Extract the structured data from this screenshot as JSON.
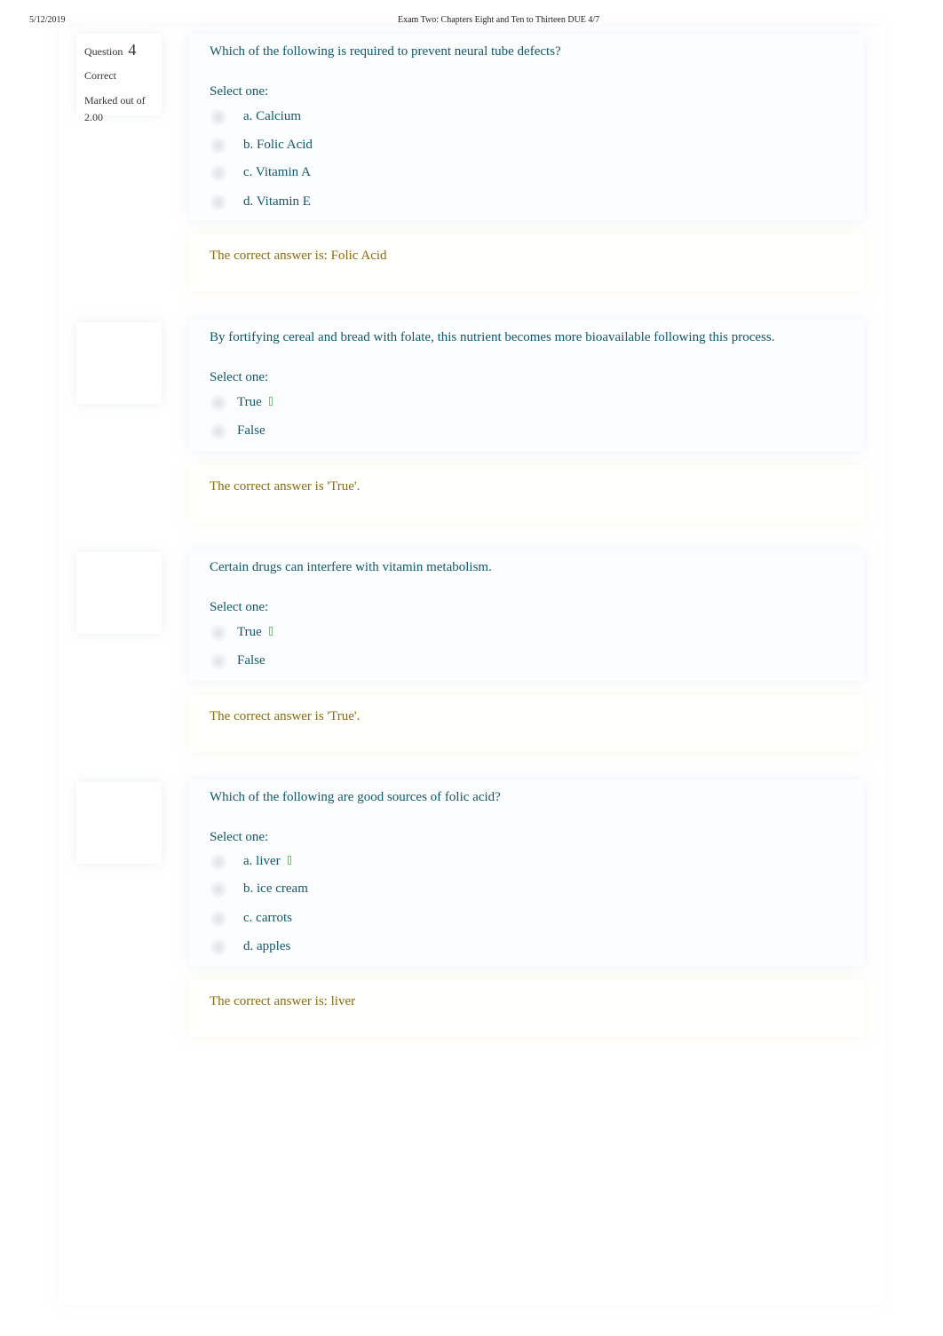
{
  "print_header": {
    "date": "5/12/2019",
    "title": "Exam Two: Chapters Eight and Ten to Thirteen DUE 4/7"
  },
  "colors": {
    "question_text": "#11586a",
    "feedback_text": "#8a6a12",
    "correct_check": "#7cc07c"
  },
  "questions": [
    {
      "info": {
        "label": "Question",
        "number": "4",
        "state": "Correct",
        "grade": "Marked out of 2.00"
      },
      "text": "Which of the following is required to prevent neural tube defects?",
      "prompt": "Select one:",
      "options": [
        {
          "label": "a. Calcium",
          "correct_mark": false
        },
        {
          "label": "b. Folic Acid",
          "correct_mark": false
        },
        {
          "label": "c. Vitamin A",
          "correct_mark": false
        },
        {
          "label": "d. Vitamin E",
          "correct_mark": false
        }
      ],
      "right_answer": "The correct answer is: Folic Acid"
    },
    {
      "info": null,
      "text": "By fortifying cereal and bread with folate, this nutrient becomes more bioavailable following this process.",
      "prompt": "Select one:",
      "options": [
        {
          "label": "True",
          "correct_mark": true,
          "icon": "check-icon"
        },
        {
          "label": "False",
          "correct_mark": false
        }
      ],
      "right_answer": "The correct answer is 'True'."
    },
    {
      "info": null,
      "text": "Certain drugs can interfere with vitamin metabolism.",
      "prompt": "Select one:",
      "options": [
        {
          "label": "True",
          "correct_mark": true,
          "icon": "check-icon"
        },
        {
          "label": "False",
          "correct_mark": false
        }
      ],
      "right_answer": "The correct answer is 'True'."
    },
    {
      "info": null,
      "text": "Which of the following are good sources of folic acid?",
      "prompt": "Select one:",
      "options": [
        {
          "label": "a. liver",
          "correct_mark": true,
          "icon": "check-icon"
        },
        {
          "label": "b. ice cream",
          "correct_mark": false
        },
        {
          "label": "c. carrots",
          "correct_mark": false
        },
        {
          "label": "d. apples",
          "correct_mark": false
        }
      ],
      "right_answer": "The correct answer is: liver"
    }
  ]
}
